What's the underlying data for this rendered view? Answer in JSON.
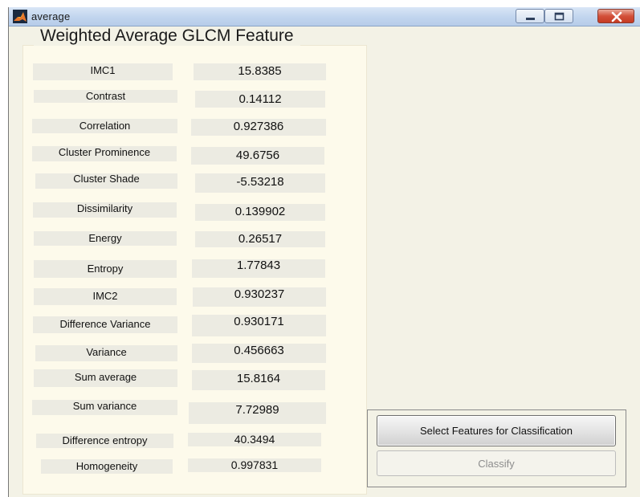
{
  "window": {
    "title": "average",
    "icon": "matlab-icon",
    "controls": [
      "minimize-icon",
      "maximize-icon",
      "close-icon"
    ]
  },
  "panel": {
    "title": "Weighted Average GLCM Feature",
    "features": [
      {
        "label": "IMC1",
        "value": "15.8385"
      },
      {
        "label": "Contrast",
        "value": "0.14112"
      },
      {
        "label": "Correlation",
        "value": "0.927386"
      },
      {
        "label": "Cluster Prominence",
        "value": "49.6756"
      },
      {
        "label": "Cluster Shade",
        "value": "-5.53218"
      },
      {
        "label": "Dissimilarity",
        "value": "0.139902"
      },
      {
        "label": "Energy",
        "value": "0.26517"
      },
      {
        "label": "Entropy",
        "value": "1.77843"
      },
      {
        "label": "IMC2",
        "value": "0.930237"
      },
      {
        "label": "Difference Variance",
        "value": "0.930171"
      },
      {
        "label": "Variance",
        "value": "0.456663"
      },
      {
        "label": "Sum average",
        "value": "15.8164"
      },
      {
        "label": "Sum variance",
        "value": "7.72989"
      },
      {
        "label": "Difference entropy",
        "value": "40.3494"
      },
      {
        "label": "Homogeneity",
        "value": "0.997831"
      }
    ]
  },
  "actions": {
    "select_label": "Select Features for Classification",
    "classify_label": "Classify",
    "classify_enabled": false
  }
}
